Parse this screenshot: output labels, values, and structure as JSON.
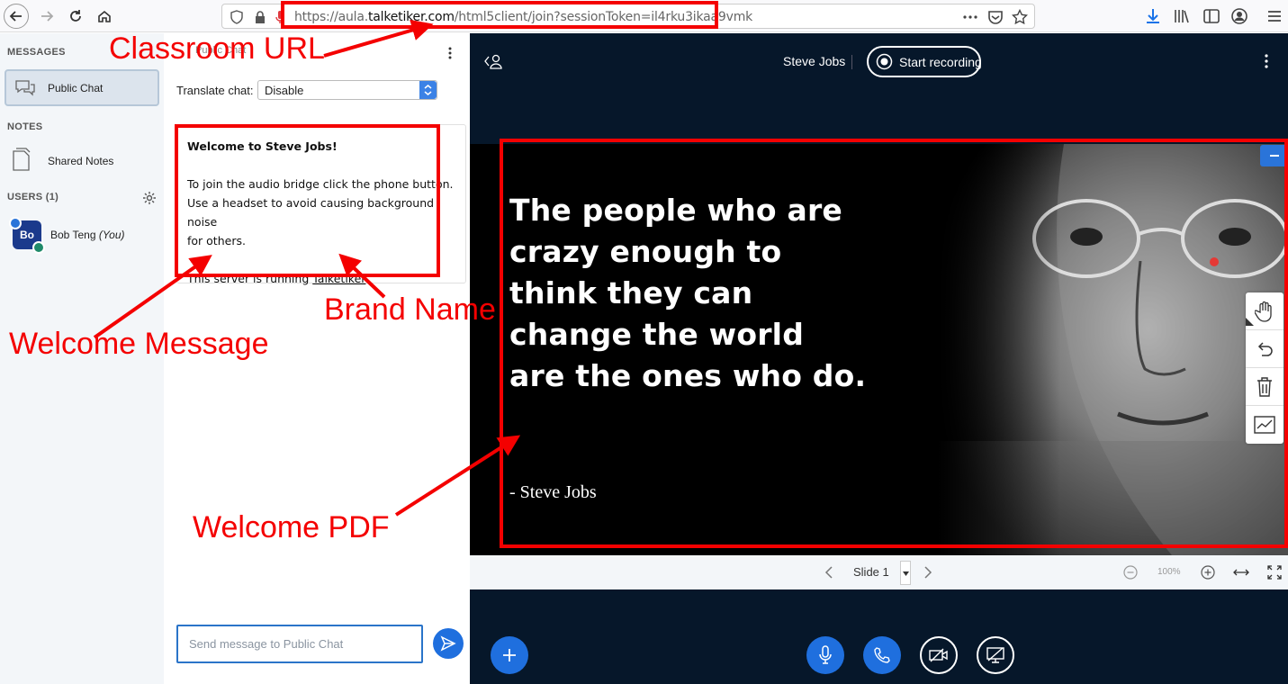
{
  "browser": {
    "url_prefix": "https://aula.",
    "url_domain": "talketiker.com",
    "url_path": "/html5client/join?sessionToken=il4rku3ikaa9vmk"
  },
  "sidebar": {
    "messages_title": "MESSAGES",
    "public_chat_label": "Public Chat",
    "notes_title": "NOTES",
    "shared_notes_label": "Shared Notes",
    "users_title": "USERS (1)",
    "user": {
      "initials": "Bo",
      "name": "Bob Teng",
      "you_tag": "(You)"
    }
  },
  "chat": {
    "title": "Public Chat",
    "translate_label": "Translate chat:",
    "translate_value": "Disable",
    "welcome": {
      "line1_prefix": "Welcome to ",
      "line1_bold": "Steve Jobs",
      "line1_suffix": "!",
      "line2": "To join the audio bridge click the phone button.",
      "line3": "Use a headset to avoid causing background noise",
      "line4": "for others.",
      "line5_prefix": "This server is running ",
      "line5_link": "Talketiker"
    },
    "input_placeholder": "Send message to Public Chat"
  },
  "presentation": {
    "presenter_name": "Steve Jobs",
    "record_label": "Start recording",
    "slide_quote": [
      "The people who are",
      "crazy enough to",
      "think they can",
      "change the world",
      "are the ones who do."
    ],
    "slide_author": "- Steve Jobs",
    "slide_selector": "Slide 1",
    "zoom": "100%"
  },
  "annotations": {
    "classroom_url": "Classroom URL",
    "welcome_message": "Welcome Message",
    "brand_name": "Brand Name",
    "welcome_pdf": "Welcome PDF"
  },
  "colors": {
    "annotation_red": "#f40000",
    "accent_blue": "#1f6fde",
    "main_bg": "#06172a",
    "sidebar_bg": "#f3f6f9"
  }
}
